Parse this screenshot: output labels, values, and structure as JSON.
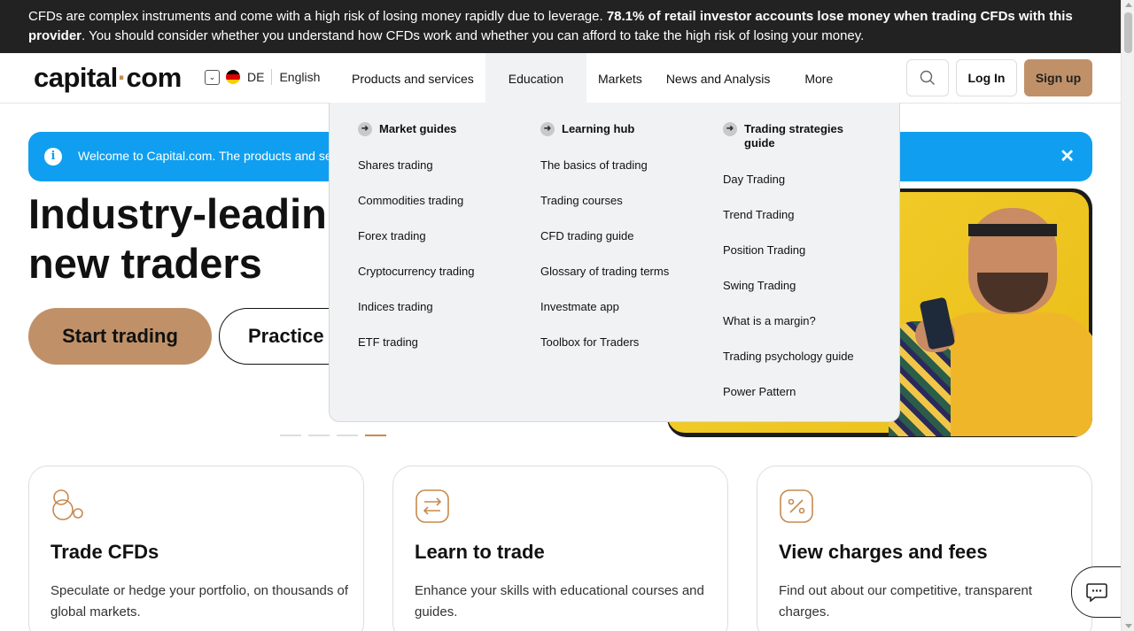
{
  "risk_banner": {
    "text_start": "CFDs are complex instruments and come with a high risk of losing money rapidly due to leverage. ",
    "text_bold": "78.1% of retail investor accounts lose money when trading CFDs with this provider",
    "text_end": ". You should consider whether you understand how CFDs work and whether you can afford to take the high risk of losing your money."
  },
  "header": {
    "logo_left": "capital",
    "logo_dot": "·",
    "logo_right": "com",
    "country": "DE",
    "language": "English",
    "nav": [
      "Products and services",
      "Education",
      "Markets",
      "News and Analysis",
      "More"
    ],
    "login": "Log In",
    "signup": "Sign up"
  },
  "notice": {
    "message": "Welcome to Capital.com. The products and serv",
    "close": "✕"
  },
  "hero": {
    "title_line1": "Industry-leadin",
    "title_line2": "new traders",
    "start_button": "Start trading",
    "practice_button": "Practice"
  },
  "dropdown": {
    "market_guides": {
      "title": "Market guides",
      "links": [
        "Shares trading",
        "Commodities trading",
        "Forex trading",
        "Cryptocurrency trading",
        "Indices trading",
        "ETF trading"
      ]
    },
    "learning_hub": {
      "title": "Learning hub",
      "links": [
        "The basics of trading",
        "Trading courses",
        "CFD trading guide",
        "Glossary of trading terms",
        "Investmate app",
        "Toolbox for Traders"
      ]
    },
    "strategies": {
      "title_line1": "Trading strategies",
      "title_line2": "guide",
      "links": [
        "Day Trading",
        "Trend Trading",
        "Position Trading",
        "Swing Trading",
        "What is a margin?",
        "Trading psychology guide",
        "Power Pattern"
      ]
    }
  },
  "cards": [
    {
      "title": "Trade CFDs",
      "text": "Speculate or hedge your portfolio, on thousands of global markets.",
      "icon": "circles-icon"
    },
    {
      "title": "Learn to trade",
      "text": "Enhance your skills with educational courses and guides.",
      "icon": "exchange-icon"
    },
    {
      "title": "View charges and fees",
      "text": "Find out about our competitive, transparent charges.",
      "icon": "percent-icon"
    }
  ],
  "colors": {
    "accent": "#c09168",
    "notice_blue": "#109ff0",
    "banner_dark": "#222222",
    "dropdown_bg": "#f1f2f4"
  }
}
